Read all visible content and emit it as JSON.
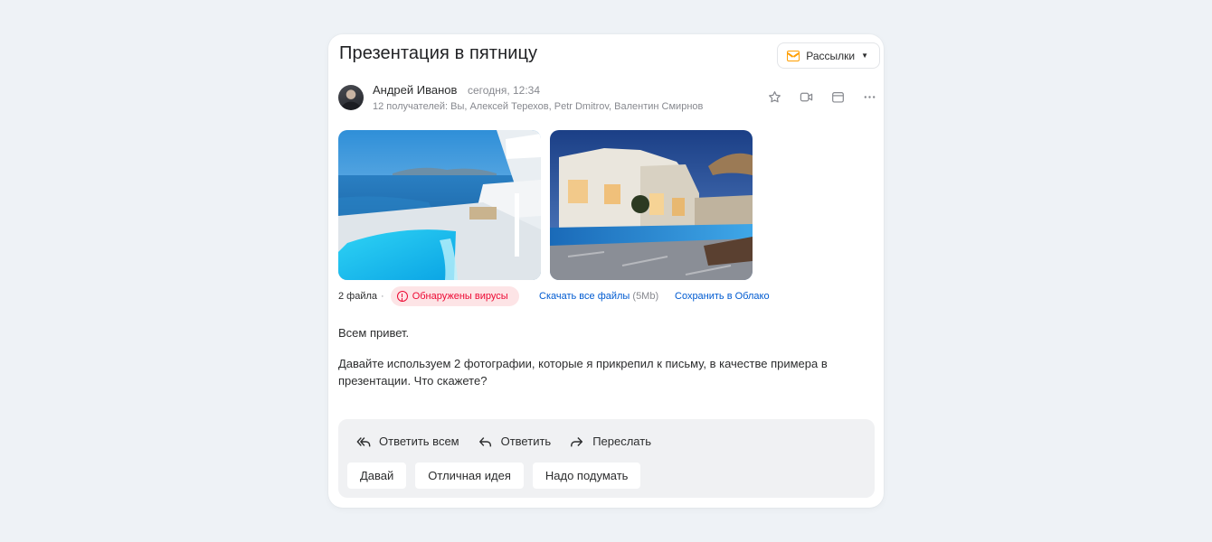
{
  "email": {
    "subject": "Презентация в пятницу",
    "newsletter_label": "Рассылки",
    "sender_name": "Андрей Иванов",
    "sent_time": "сегодня, 12:34",
    "recipients": "12 получателей: Вы, Алексей Терехов, Petr Dmitrov, Валентин Смирнов"
  },
  "attachments": {
    "count_label": "2 файла",
    "separator": "·",
    "virus_warning": "Обнаружены вирусы",
    "download_all": "Скачать все файлы",
    "download_size": "(5Mb)",
    "save_to_cloud": "Сохранить в Облако"
  },
  "body": {
    "greeting": "Всем привет.",
    "paragraph": "Давайте используем 2 фотографии, которые я прикрепил к письму, в качестве примера в презентации. Что скажете?"
  },
  "reply": {
    "reply_all": "Ответить всем",
    "reply": "Ответить",
    "forward": "Переслать",
    "quick_replies": [
      "Давай",
      "Отличная идея",
      "Надо подумать"
    ]
  },
  "colors": {
    "background": "#eef2f6",
    "link": "#005bd1",
    "virus": "#ed0a34",
    "virus_bg": "#fde4e6",
    "newsletter_icon": "#ff9e00"
  },
  "icons": {
    "header_actions": [
      "star-icon",
      "video-icon",
      "calendar-icon",
      "more-icon"
    ]
  }
}
